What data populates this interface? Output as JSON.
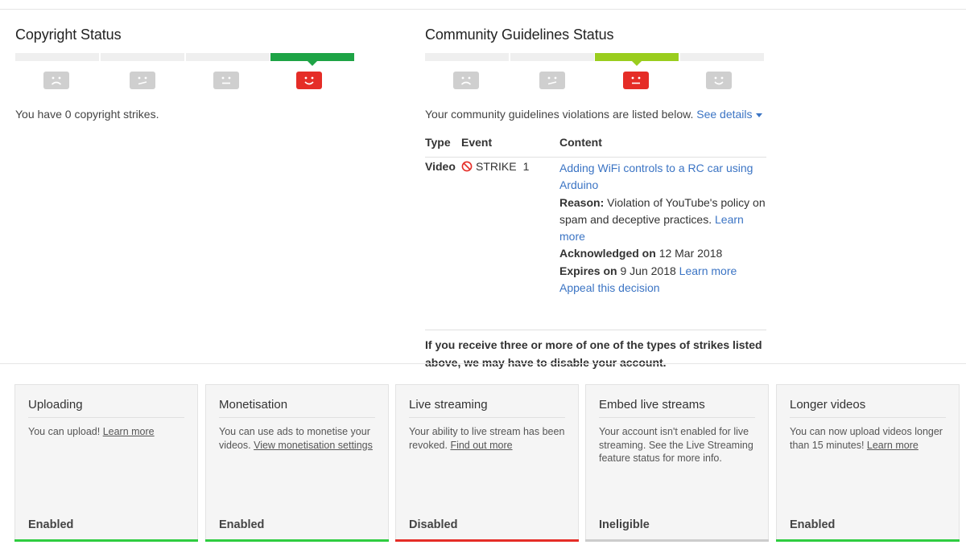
{
  "copyright": {
    "title": "Copyright Status",
    "message": "You have 0 copyright strikes.",
    "active_color": "#1ea446",
    "active_index": 3
  },
  "community": {
    "title": "Community Guidelines Status",
    "intro": "Your community guidelines violations are listed below.",
    "see_details": "See details",
    "active_color": "#9acd1e",
    "active_index": 2,
    "table": {
      "headers": {
        "type": "Type",
        "event": "Event",
        "content": "Content"
      },
      "row": {
        "type": "Video",
        "event": "STRIKE",
        "count": "1",
        "video_title": "Adding WiFi controls to a RC car using Arduino",
        "reason_label": "Reason:",
        "reason_text": "Violation of YouTube's policy on spam and deceptive practices.",
        "reason_link": "Learn more",
        "acknowledged_label": "Acknowledged on",
        "acknowledged_date": "12 Mar 2018",
        "expires_label": "Expires on",
        "expires_date": "9 Jun 2018",
        "expires_link": "Learn more",
        "appeal": "Appeal this decision"
      }
    },
    "warning": "If you receive three or more of one of the types of strikes listed above, we may have to disable your account."
  },
  "cards": [
    {
      "title": "Uploading",
      "desc": "You can upload!",
      "link": "Learn more",
      "status": "Enabled",
      "bar_color": "#2ecc40"
    },
    {
      "title": "Monetisation",
      "desc": "You can use ads to monetise your videos.",
      "link": "View monetisation settings",
      "status": "Enabled",
      "bar_color": "#2ecc40"
    },
    {
      "title": "Live streaming",
      "desc": "Your ability to live stream has been revoked.",
      "link": "Find out more",
      "status": "Disabled",
      "bar_color": "#e52d27"
    },
    {
      "title": "Embed live streams",
      "desc": "Your account isn't enabled for live streaming. See the Live Streaming feature status for more info.",
      "link": "",
      "status": "Ineligible",
      "bar_color": "#cccccc"
    },
    {
      "title": "Longer videos",
      "desc": "You can now upload videos longer than 15 minutes!",
      "link": "Learn more",
      "status": "Enabled",
      "bar_color": "#2ecc40"
    }
  ]
}
